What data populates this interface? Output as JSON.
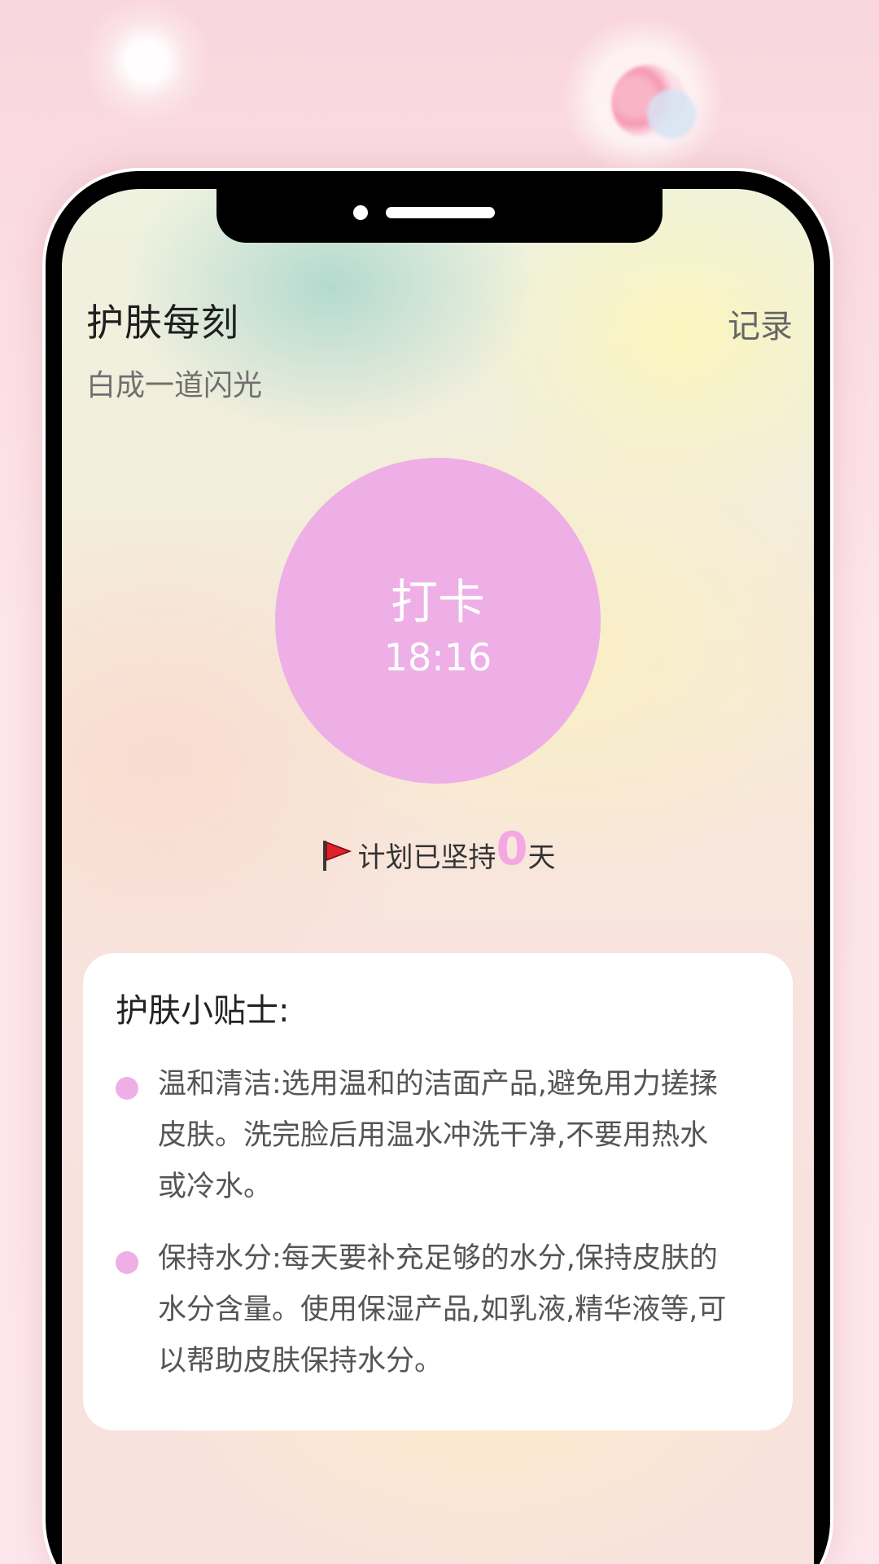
{
  "app": {
    "title": "护肤每刻",
    "subtitle": "白成一道闪光",
    "record_link": "记录"
  },
  "checkin": {
    "label": "打卡",
    "time": "18:16"
  },
  "streak": {
    "prefix": "计划已坚持",
    "count": "0",
    "suffix": "天"
  },
  "tips": {
    "title": "护肤小贴士:",
    "items": [
      {
        "text": "温和清洁:选用温和的洁面产品,避免用力搓揉皮肤。洗完脸后用温水冲洗干净,不要用热水或冷水。"
      },
      {
        "text": "保持水分:每天要补充足够的水分,保持皮肤的水分含量。使用保湿产品,如乳液,精华液等,可以帮助皮肤保持水分。"
      }
    ]
  },
  "colors": {
    "accent_pink": "#eeaee6",
    "streak_count": "#f3a8e4",
    "flag_red": "#e0202a"
  },
  "icons": {
    "streak_icon": "red-flag-icon"
  }
}
